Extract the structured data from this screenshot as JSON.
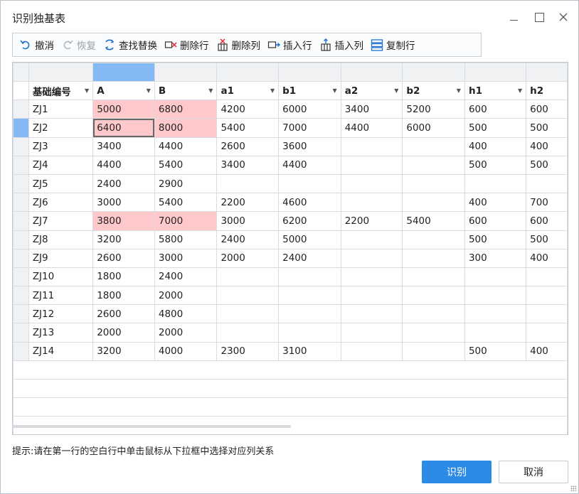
{
  "window": {
    "title": "识别独基表"
  },
  "toolbar": {
    "items": [
      {
        "label": "撤消",
        "icon": "undo-icon",
        "enabled": true
      },
      {
        "label": "恢复",
        "icon": "redo-icon",
        "enabled": false
      },
      {
        "label": "查找替换",
        "icon": "find-replace-icon",
        "enabled": true
      },
      {
        "label": "删除行",
        "icon": "delete-row-icon",
        "enabled": true
      },
      {
        "label": "删除列",
        "icon": "delete-column-icon",
        "enabled": true
      },
      {
        "label": "插入行",
        "icon": "insert-row-icon",
        "enabled": true
      },
      {
        "label": "插入列",
        "icon": "insert-column-icon",
        "enabled": true
      },
      {
        "label": "复制行",
        "icon": "copy-row-icon",
        "enabled": true
      }
    ]
  },
  "grid": {
    "headers": [
      "基础编号",
      "A",
      "B",
      "a1",
      "b1",
      "a2",
      "b2",
      "h1",
      "h2"
    ],
    "rows": [
      [
        "ZJ1",
        "5000",
        "6800",
        "4200",
        "6000",
        "3400",
        "5200",
        "600",
        "600"
      ],
      [
        "ZJ2",
        "6400",
        "8000",
        "5400",
        "7000",
        "4400",
        "6000",
        "500",
        "500"
      ],
      [
        "ZJ3",
        "3400",
        "4400",
        "2600",
        "3600",
        "",
        "",
        "400",
        "400"
      ],
      [
        "ZJ4",
        "4400",
        "5400",
        "3400",
        "4400",
        "",
        "",
        "500",
        "500"
      ],
      [
        "ZJ5",
        "2400",
        "2900",
        "",
        "",
        "",
        "",
        "",
        ""
      ],
      [
        "ZJ6",
        "3000",
        "5400",
        "2200",
        "4600",
        "",
        "",
        "400",
        "700"
      ],
      [
        "ZJ7",
        "3800",
        "7000",
        "3000",
        "6200",
        "2200",
        "5400",
        "600",
        "600"
      ],
      [
        "ZJ8",
        "3200",
        "5800",
        "2400",
        "5000",
        "",
        "",
        "500",
        "500"
      ],
      [
        "ZJ9",
        "2600",
        "3000",
        "2000",
        "2400",
        "",
        "",
        "300",
        "400"
      ],
      [
        "ZJ10",
        "1800",
        "2400",
        "",
        "",
        "",
        "",
        "",
        ""
      ],
      [
        "ZJ11",
        "1800",
        "2000",
        "",
        "",
        "",
        "",
        "",
        ""
      ],
      [
        "ZJ12",
        "2600",
        "4800",
        "",
        "",
        "",
        "",
        "",
        ""
      ],
      [
        "ZJ13",
        "2000",
        "2000",
        "",
        "",
        "",
        "",
        "",
        ""
      ],
      [
        "ZJ14",
        "3200",
        "4000",
        "2300",
        "3100",
        "",
        "",
        "500",
        "400"
      ]
    ],
    "highlighted_rows": [
      0,
      1,
      6
    ],
    "selected_row": 1,
    "selected_column": 1,
    "colors": {
      "highlight": "#ffc9cb",
      "selection": "#84b9f5"
    }
  },
  "footer": {
    "hint": "提示:请在第一行的空白行中单击鼠标从下拉框中选择对应列关系",
    "ok_label": "识别",
    "cancel_label": "取消"
  }
}
